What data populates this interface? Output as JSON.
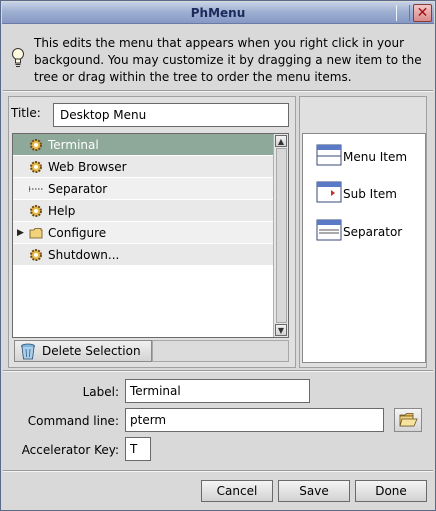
{
  "window": {
    "title": "PhMenu",
    "close_glyph": "✕"
  },
  "info": {
    "icon": "lightbulb-icon",
    "text": "This edits the menu that appears when you right click in your backgound.  You may customize it by dragging a new item to the tree or drag within the tree to order the menu items."
  },
  "editor": {
    "title_label": "Title:",
    "title_value": "Desktop Menu",
    "tree": [
      {
        "label": "Terminal",
        "icon": "gear-icon",
        "selected": true
      },
      {
        "label": "Web Browser",
        "icon": "gear-icon"
      },
      {
        "label": "Separator",
        "icon": "separator-icon"
      },
      {
        "label": "Help",
        "icon": "gear-icon"
      },
      {
        "label": "Configure",
        "icon": "folder-icon",
        "expander": "▶"
      },
      {
        "label": "Shutdown...",
        "icon": "gear-icon"
      }
    ],
    "delete_label": "Delete Selection"
  },
  "palette": {
    "items": [
      {
        "label": "Menu Item",
        "icon": "menu-item-icon"
      },
      {
        "label": "Sub Item",
        "icon": "sub-item-icon"
      },
      {
        "label": "Separator",
        "icon": "separator-item-icon"
      }
    ]
  },
  "details": {
    "label_label": "Label:",
    "label_value": "Terminal",
    "command_label": "Command line:",
    "command_value": "pterm",
    "accel_label": "Accelerator Key:",
    "accel_value": "T"
  },
  "buttons": {
    "cancel": "Cancel",
    "save": "Save",
    "done": "Done"
  },
  "colors": {
    "selection": "#8ea89a",
    "titlebar": "#9fb0d2",
    "window_bg": "#d9d9d9"
  }
}
